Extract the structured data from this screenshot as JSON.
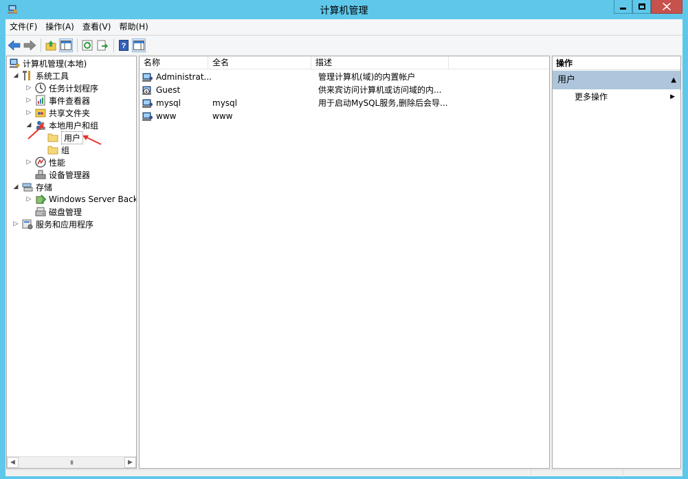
{
  "window": {
    "title": "计算机管理"
  },
  "menubar": [
    {
      "label": "文件(F)"
    },
    {
      "label": "操作(A)"
    },
    {
      "label": "查看(V)"
    },
    {
      "label": "帮助(H)"
    }
  ],
  "toolbar": {
    "icons": [
      "back-icon",
      "forward-icon",
      "up-folder-icon",
      "show-hide-tree-icon",
      "refresh-icon",
      "export-list-icon",
      "help-icon",
      "show-hide-action-pane-icon"
    ]
  },
  "tree": {
    "root": "计算机管理(本地)",
    "system_tools": "系统工具",
    "task_scheduler": "任务计划程序",
    "event_viewer": "事件查看器",
    "shared_folders": "共享文件夹",
    "local_users_groups": "本地用户和组",
    "users": "用户",
    "groups": "组",
    "performance": "性能",
    "device_manager": "设备管理器",
    "storage": "存储",
    "windows_server_backup": "Windows Server Back",
    "disk_management": "磁盘管理",
    "services_apps": "服务和应用程序",
    "scroll_grip": "III"
  },
  "list": {
    "columns": [
      "名称",
      "全名",
      "描述"
    ],
    "rows": [
      {
        "name": "Administrat...",
        "fullname": "",
        "description": "管理计算机(域)的内置帐户"
      },
      {
        "name": "Guest",
        "fullname": "",
        "description": "供来宾访问计算机或访问域的内..."
      },
      {
        "name": "mysql",
        "fullname": "mysql",
        "description": "用于启动MySQL服务,删除后会导..."
      },
      {
        "name": "www",
        "fullname": "www",
        "description": ""
      }
    ]
  },
  "actions": {
    "title": "操作",
    "section": "用户",
    "more": "更多操作"
  },
  "colors": {
    "titlebar": "#5fc8ea",
    "close_button": "#c7514c",
    "action_section": "#aec5db",
    "annotation_arrow": "#e8322b"
  }
}
